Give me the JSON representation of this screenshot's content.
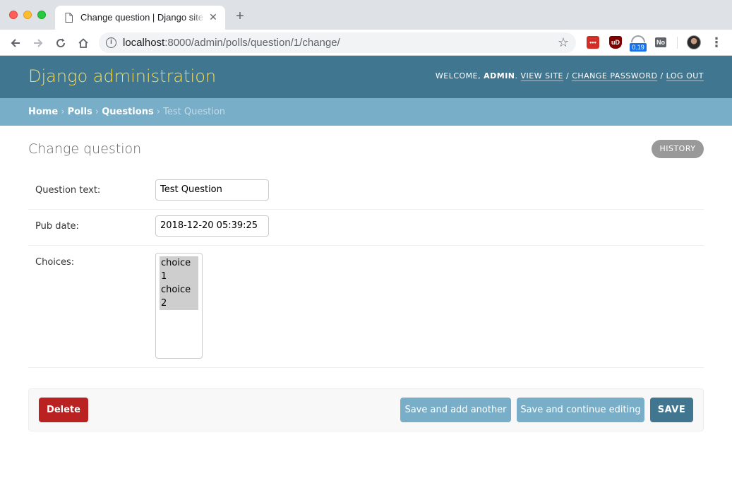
{
  "browser": {
    "tab_title": "Change question | Django site admin",
    "tab_close": "✕",
    "new_tab": "+",
    "url_host": "localhost",
    "url_path": ":8000/admin/polls/question/1/change/",
    "extensions": {
      "lastpass": "•••",
      "ublock": "uD",
      "speed_badge": "0.19",
      "no_label": "No"
    },
    "icons": [
      "back-icon",
      "forward-icon",
      "reload-icon",
      "home-icon",
      "info-icon",
      "star-icon",
      "menu-dots-icon"
    ]
  },
  "header": {
    "brand": "Django administration",
    "welcome": "WELCOME, ",
    "username": "ADMIN",
    "after_user": ". ",
    "view_site": "VIEW SITE",
    "sep": " / ",
    "change_password": "CHANGE PASSWORD",
    "log_out": "LOG OUT"
  },
  "breadcrumbs": {
    "home": "Home",
    "polls": "Polls",
    "questions": "Questions",
    "current": "Test Question",
    "separator": " › "
  },
  "main": {
    "title": "Change question",
    "history": "HISTORY",
    "fields": {
      "question_text_label": "Question text:",
      "question_text_value": "Test Question",
      "pub_date_label": "Pub date:",
      "pub_date_value": "2018-12-20 05:39:25",
      "choices_label": "Choices:",
      "choices": [
        "choice 1",
        "choice 2"
      ]
    },
    "buttons": {
      "delete": "Delete",
      "save_add_another": "Save and add another",
      "save_continue": "Save and continue editing",
      "save": "SAVE"
    }
  },
  "colors": {
    "header_bg": "#417690",
    "brand": "#f5dd5d",
    "breadcrumb_bg": "#79aec8",
    "delete": "#ba2121",
    "secondary_button": "#79aec8",
    "primary_button": "#417690"
  }
}
